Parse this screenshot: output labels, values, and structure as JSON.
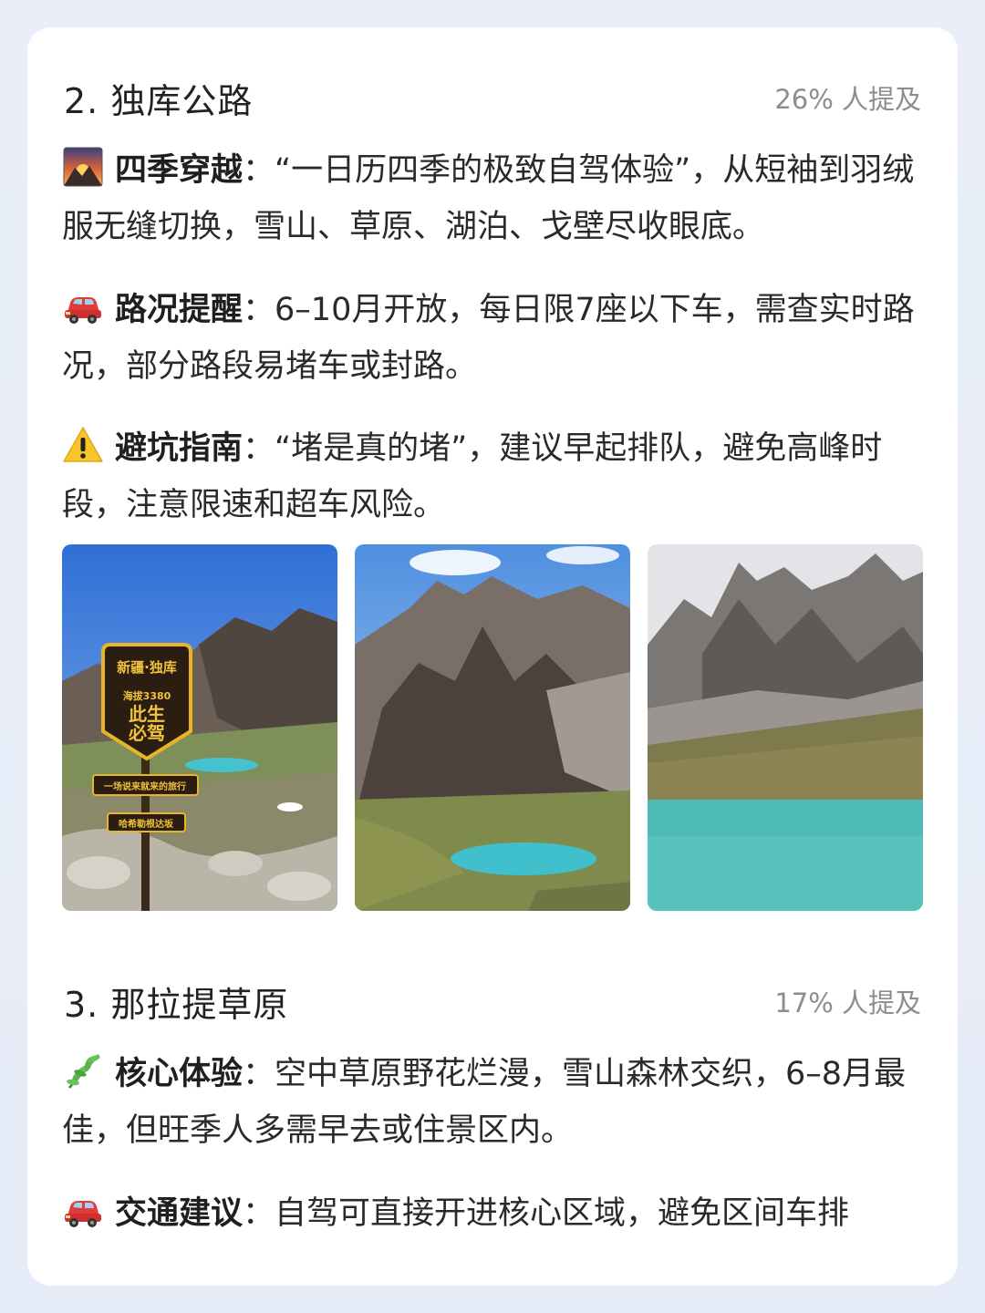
{
  "section2": {
    "title": "2. 独库公路",
    "mention": "26% 人提及",
    "items": [
      {
        "icon": "sunrise-mountain-icon",
        "label": "四季穿越",
        "sep": "：",
        "text": "“一日历四季的极致自驾体验”，从短袖到羽绒服无缝切换，雪山、草原、湖泊、戈壁尽收眼底。"
      },
      {
        "icon": "red-car-icon",
        "label": "路况提醒",
        "sep": "：",
        "text": "6–10月开放，每日限7座以下车，需查实时路况，部分路段易堵车或封路。"
      },
      {
        "icon": "warning-icon",
        "label": "避坑指南",
        "sep": "：",
        "text": "“堵是真的堵”，建议早起排队，避免高峰时段，注意限速和超车风险。"
      }
    ],
    "photo_sign": {
      "line1": "新疆·独库",
      "line2": "海拔3380",
      "line3": "此生",
      "line4": "必驾",
      "plate1": "一场说来就来的旅行",
      "plate2": "哈希勒根达坂"
    }
  },
  "section3": {
    "title": "3. 那拉提草原",
    "mention": "17% 人提及",
    "items": [
      {
        "icon": "herb-icon",
        "label": "核心体验",
        "sep": "：",
        "text": "空中草原野花烂漫，雪山森林交织，6–8月最佳，但旺季人多需早去或住景区内。"
      },
      {
        "icon": "red-car-icon",
        "label": "交通建议",
        "sep": "：",
        "text": "自驾可直接开进核心区域，避免区间车排"
      }
    ]
  }
}
